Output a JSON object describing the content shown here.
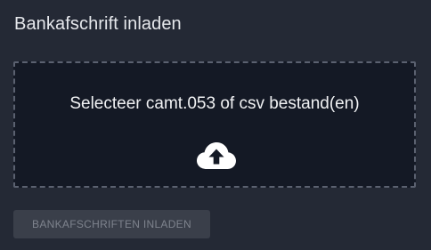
{
  "panel": {
    "title": "Bankafschrift inladen"
  },
  "dropzone": {
    "label": "Selecteer camt.053 of csv bestand(en)",
    "icon": "cloud-upload-icon"
  },
  "actions": {
    "submit_label": "BANKAFSCHRIFTEN INLADEN",
    "submit_disabled": true
  },
  "colors": {
    "background": "#242935",
    "dropzone_bg": "#141925",
    "dropzone_border": "#5b6170",
    "text": "#e6e8ec",
    "button_bg": "#3a3f4a",
    "button_text": "#7e838d"
  }
}
